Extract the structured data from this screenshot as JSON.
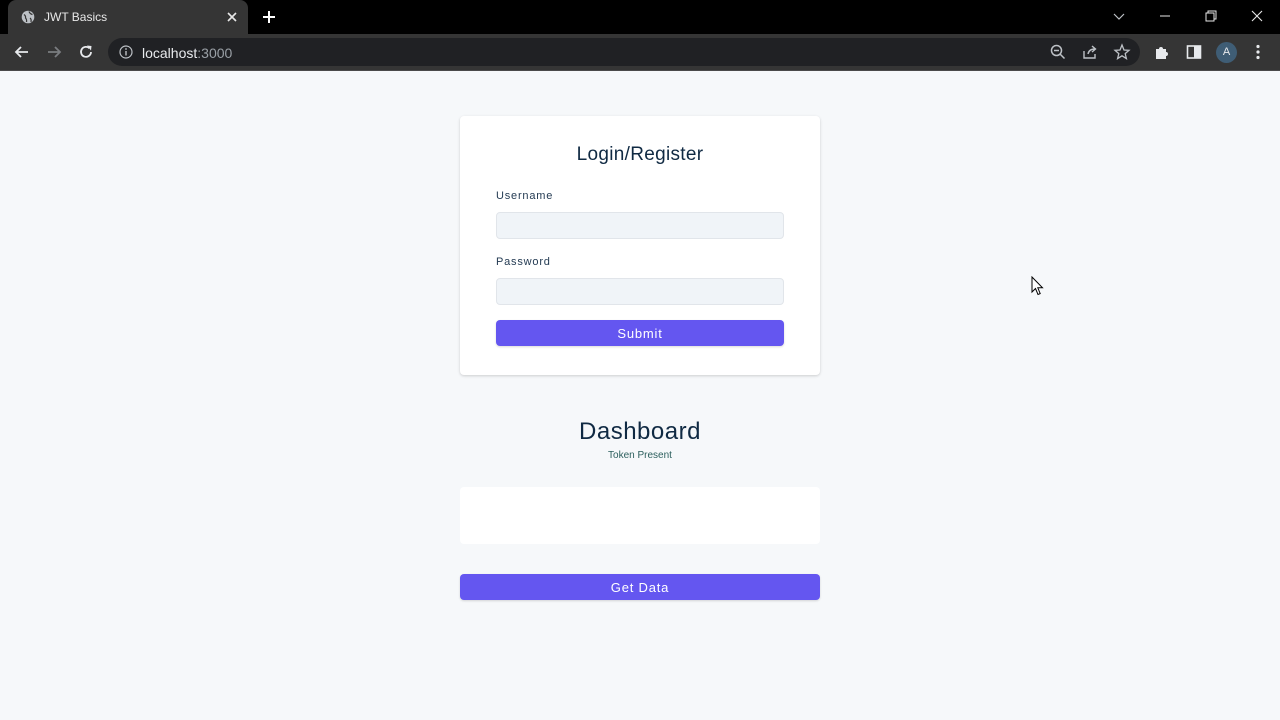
{
  "browser": {
    "tab": {
      "title": "JWT Basics"
    },
    "address": {
      "host": "localhost",
      "port": ":3000"
    },
    "profile": {
      "initial": "A"
    }
  },
  "login": {
    "title": "Login/Register",
    "username_label": "Username",
    "username_value": "",
    "password_label": "Password",
    "password_value": "",
    "submit_label": "Submit"
  },
  "dashboard": {
    "title": "Dashboard",
    "token_status": "Token Present",
    "result_text": "",
    "get_data_label": "Get Data"
  },
  "colors": {
    "accent": "#6456f0",
    "page_background": "#f6f8fa",
    "chrome_dark": "#353535"
  },
  "icons": [
    "globe-icon",
    "close-icon",
    "plus-icon",
    "chevron-down-icon",
    "minimize-icon",
    "restore-icon",
    "window-close-icon",
    "back-arrow-icon",
    "forward-arrow-icon",
    "reload-icon",
    "info-icon",
    "zoom-icon",
    "share-icon",
    "star-icon",
    "extensions-icon",
    "side-panel-icon",
    "kebab-menu-icon",
    "cursor-icon"
  ]
}
